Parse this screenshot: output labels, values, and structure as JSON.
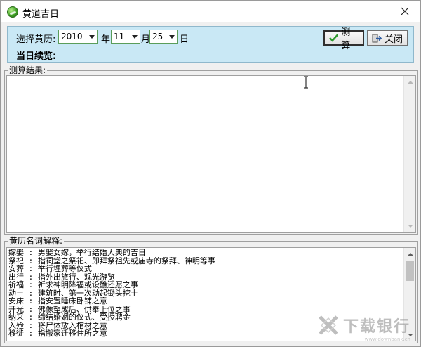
{
  "window": {
    "title": "黄道吉日"
  },
  "picker": {
    "label": "选择黄历:",
    "year": "2010",
    "year_unit": "年",
    "month": "11",
    "month_unit": "月",
    "day": "25",
    "day_unit": "日",
    "today_label": "当日续览:"
  },
  "toolbar": {
    "calc_label": "测算",
    "close_label": "关闭"
  },
  "result": {
    "title": "测算结果:"
  },
  "glossary": {
    "title": "黄历名词解释:",
    "items": [
      "嫁娶 : 男娶女嫁，举行结婚大典的吉日",
      "祭祀 : 指祠堂之祭祀、即拜祭祖先或庙寺的祭拜、神明等事",
      "安葬 : 举行埋葬等仪式",
      "出行 : 指外出旅行、观光游览",
      "祈福 : 祈求神明降福或设醮还愿之事",
      "动土 : 建筑时、第一次动起锄头挖土",
      "安床 : 指安置睡床卧铺之意",
      "开光 : 佛像塑成后、供奉上位之事",
      "纳采 : 缔结婚姻的仪式、受授聘金",
      "入殓 : 将尸体放入棺材之意",
      "移徙 : 指搬家迁移住所之意"
    ]
  },
  "watermark": {
    "text": "下载银行",
    "sub": "www.downbank.cn"
  },
  "colors": {
    "panel": "#c9e8f5",
    "accent": "#2e9a2e",
    "combo_border": "#5a9d5a"
  }
}
